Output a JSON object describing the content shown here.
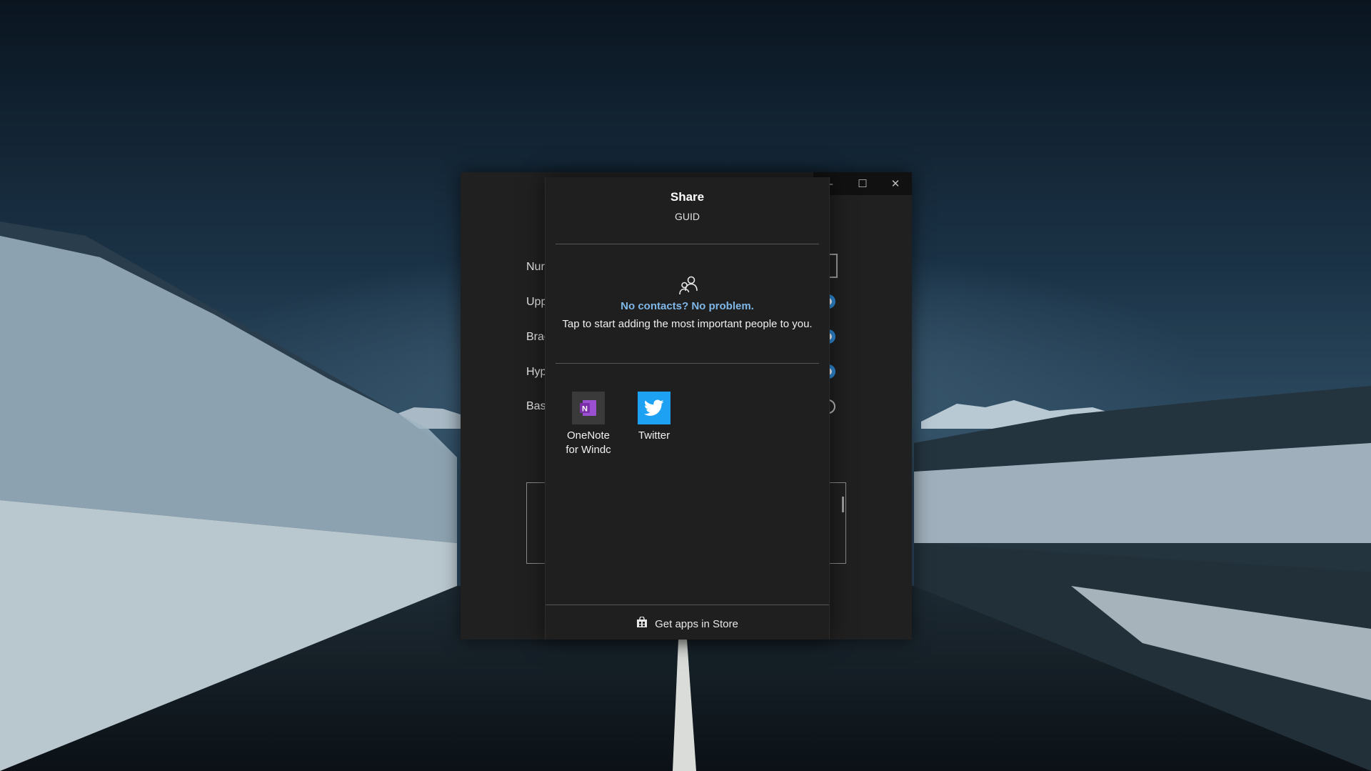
{
  "app_window": {
    "controls": {
      "minimize": "–",
      "maximize": "☐",
      "close": "✕"
    },
    "rows": [
      "Nur",
      "Upp",
      "Brac",
      "Hyp",
      "Bas"
    ],
    "toggles": [
      "on",
      "on",
      "on",
      "off"
    ]
  },
  "share": {
    "title": "Share",
    "subtitle": "GUID",
    "contacts": {
      "icon": "people-icon",
      "heading": "No contacts? No problem.",
      "body": "Tap to start adding the most important people to you."
    },
    "apps": [
      {
        "label_line1": "OneNote",
        "label_line2": "for Windc",
        "icon": "onenote-icon",
        "color": "#7b2fa8"
      },
      {
        "label_line1": "Twitter",
        "label_line2": "",
        "icon": "twitter-icon",
        "color": "#1da1f2"
      }
    ],
    "store": {
      "label": "Get apps in Store",
      "icon": "store-bag-icon"
    }
  },
  "colors": {
    "accent": "#2f8bd8",
    "link": "#7fb8e8"
  }
}
